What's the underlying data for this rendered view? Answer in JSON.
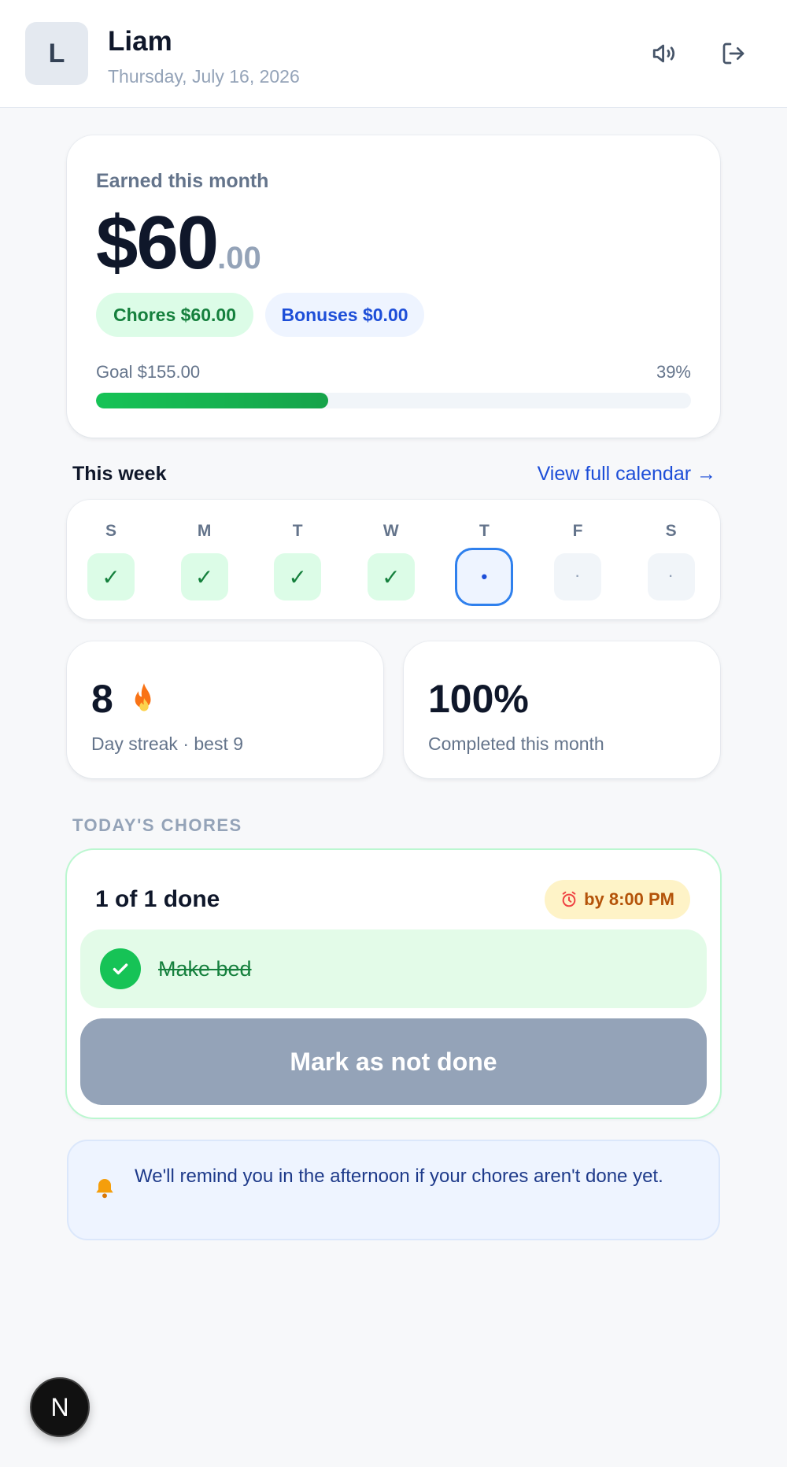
{
  "header": {
    "avatar_letter": "L",
    "name": "Liam",
    "date": "Thursday, July 16, 2026",
    "sound_icon": "speaker-icon",
    "logout_icon": "logout-icon"
  },
  "earnings": {
    "label": "Earned this month",
    "amount_main": "$60",
    "amount_cents": ".00",
    "chores_pill": "Chores $60.00",
    "bonuses_pill": "Bonuses $0.00",
    "goal_label": "Goal $155.00",
    "goal_percent_label": "39%",
    "goal_progress": 0.39
  },
  "week": {
    "title": "This week",
    "link": "View full calendar →",
    "days": [
      {
        "letter": "S",
        "status": "done",
        "mark": "✓"
      },
      {
        "letter": "M",
        "status": "done",
        "mark": "✓"
      },
      {
        "letter": "T",
        "status": "done",
        "mark": "✓"
      },
      {
        "letter": "W",
        "status": "done",
        "mark": "✓"
      },
      {
        "letter": "T",
        "status": "today",
        "mark": "•"
      },
      {
        "letter": "F",
        "status": "future",
        "mark": "·"
      },
      {
        "letter": "S",
        "status": "future",
        "mark": "·"
      }
    ]
  },
  "stats": {
    "streak_value": "8",
    "streak_icon": "fire-icon",
    "streak_label": "Day streak · best 9",
    "completion_value": "100%",
    "completion_label": "Completed this month"
  },
  "chores": {
    "section_title": "TODAY'S CHORES",
    "done_count": "1 of 1 done",
    "due_icon": "alarm-clock-icon",
    "due_label": "by 8:00 PM",
    "items": [
      {
        "name": "Make bed",
        "done": true
      }
    ],
    "undo_button": "Mark as not done"
  },
  "reminder": {
    "icon": "bell-icon",
    "text": "We'll remind you in the afternoon if your chores aren't done yet."
  },
  "dev_badge": {
    "letter": "N"
  },
  "colors": {
    "accent_green": "#16c356",
    "accent_blue": "#1d4ed8",
    "amber": "#b45309",
    "muted": "#94a3b8"
  }
}
